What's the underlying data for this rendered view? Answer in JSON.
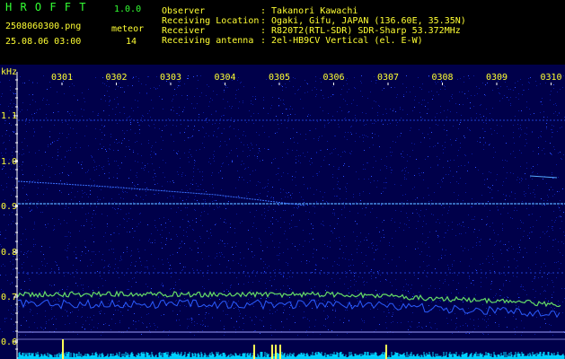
{
  "app": {
    "logo": "H R O F F T",
    "version": "1.0.0",
    "filename": "2508060300.png",
    "datetime": "25.08.06 03:00",
    "meteor_label": "meteor",
    "meteor_count": "14"
  },
  "info": {
    "observer_label": "Observer",
    "observer_value": ": Takanori Kawachi",
    "location_label": "Receiving Location",
    "location_value": ": Ogaki, Gifu, JAPAN (136.60E, 35.35N)",
    "receiver_label": "Receiver",
    "receiver_value": ": R820T2(RTL-SDR) SDR-Sharp 53.372MHz",
    "antenna_label": "Receiving antenna",
    "antenna_value": ": 2el-HB9CV Vertical (el. E-W)"
  },
  "spectrogram": {
    "unit_label": "kHz",
    "time_labels": [
      "0301",
      "0302",
      "0303",
      "0304",
      "0305",
      "0306",
      "0307",
      "0308",
      "0309",
      "0310"
    ],
    "freq_labels": [
      "1.1",
      "1.0",
      "0.9",
      "0.8",
      "0.7",
      "0.6"
    ],
    "colors": {
      "background": "#00004a",
      "noise": "#0a1aa0",
      "signal": "#55aaff",
      "strong": "#ffff55",
      "axis_text": "#ffff33"
    }
  }
}
